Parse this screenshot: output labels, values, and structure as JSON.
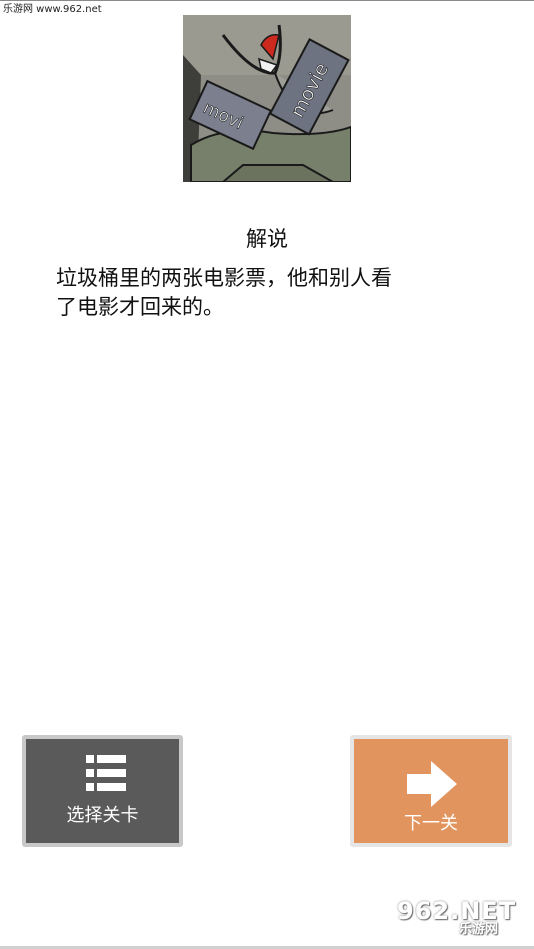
{
  "watermark": {
    "top_text": "乐游网 www.962.net",
    "bottom_brand": "962.NET",
    "bottom_sub": "乐游网"
  },
  "illustration": {
    "ticket_text_left": "movi",
    "ticket_text_right": "movie"
  },
  "explanation": {
    "heading": "解说",
    "body_line1": "垃圾桶里的两张电影票，他和别人看",
    "body_line2": "了电影才回来的。"
  },
  "buttons": {
    "select_level_label": "选择关卡",
    "select_level_icon": "list-icon",
    "next_level_label": "下一关",
    "next_level_icon": "arrow-right-icon"
  },
  "colors": {
    "select_button_bg": "#5a5a5a",
    "next_button_bg": "#e1945e",
    "button_text": "#ffffff"
  }
}
